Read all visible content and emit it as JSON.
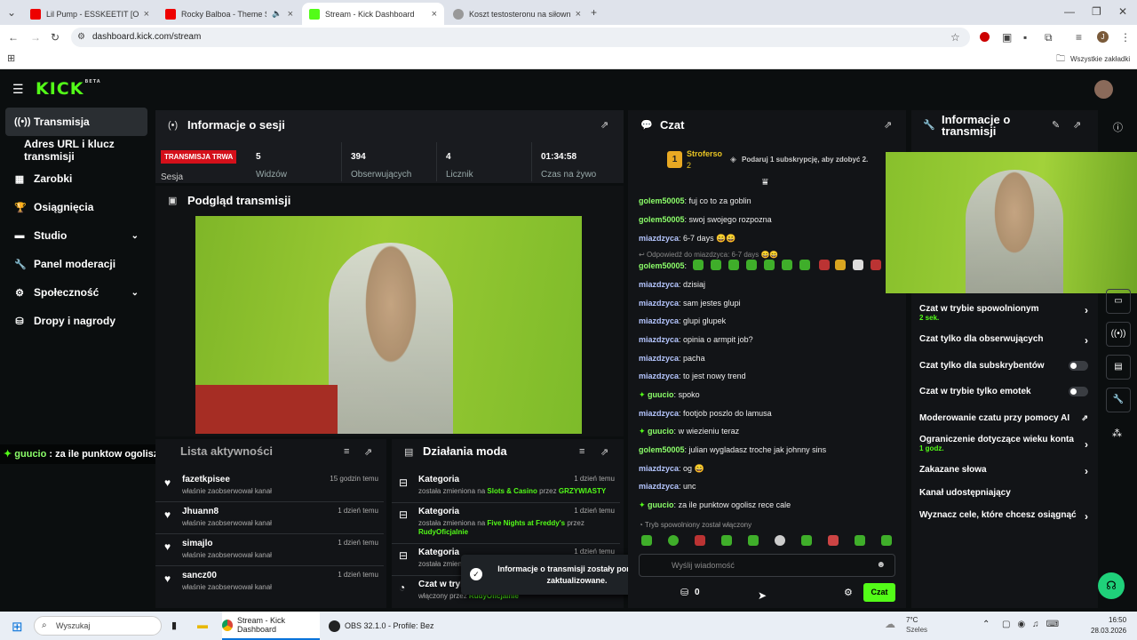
{
  "browser": {
    "tabs": [
      {
        "title": "Lil Pump - ESSKEETIT [Official M"
      },
      {
        "title": "Rocky Balboa - Theme Song"
      },
      {
        "title": "Stream - Kick Dashboard"
      },
      {
        "title": "Koszt testosteronu na siłownie"
      }
    ],
    "url": "dashboard.kick.com/stream",
    "bookmarks_label": "Wszystkie zakładki",
    "profile_initial": "J"
  },
  "kick": {
    "logo": "KICK",
    "logo_badge": "BETA"
  },
  "sidebar": {
    "items": [
      {
        "label": "Transmisja"
      },
      {
        "label": "Adres URL i klucz transmisji"
      },
      {
        "label": "Zarobki"
      },
      {
        "label": "Osiągnięcia"
      },
      {
        "label": "Studio"
      },
      {
        "label": "Panel moderacji"
      },
      {
        "label": "Społeczność"
      },
      {
        "label": "Dropy i nagrody"
      }
    ]
  },
  "session": {
    "title": "Informacje o sesji",
    "live_badge": "TRANSMISJA TRWA",
    "session_label": "Sesja",
    "stats": [
      {
        "value": "5",
        "label": "Widzów"
      },
      {
        "value": "394",
        "label": "Obserwujących"
      },
      {
        "value": "4",
        "label": "Licznik"
      },
      {
        "value": "01:34:58",
        "label": "Czas na żywo"
      }
    ]
  },
  "preview": {
    "title": "Podgląd transmisji"
  },
  "overlay_chat": {
    "user": "guucio",
    "text": " : za ile punktow ogolisz rece cale"
  },
  "activity": {
    "title": "Lista aktywności",
    "items": [
      {
        "name": "fazetkpisee",
        "sub": "właśnie zaobserwował kanał",
        "time": "15 godzin temu"
      },
      {
        "name": "Jhuann8",
        "sub": "właśnie zaobserwował kanał",
        "time": "1 dzień temu"
      },
      {
        "name": "simajlo",
        "sub": "właśnie zaobserwował kanał",
        "time": "1 dzień temu"
      },
      {
        "name": "sancz00",
        "sub": "właśnie zaobserwował kanał",
        "time": "1 dzień temu"
      }
    ]
  },
  "mod": {
    "title": "Działania moda",
    "items": [
      {
        "name": "Kategoria",
        "sub_pre": "została zmieniona na ",
        "cat": "Slots & Casino",
        "sub_mid": " przez ",
        "by": "GRZYWIASTY",
        "time": "1 dzień temu"
      },
      {
        "name": "Kategoria",
        "sub_pre": "została zmieniona na ",
        "cat": "Five Nights at Freddy's",
        "sub_mid": " przez ",
        "by": "RudyOficjalnie",
        "time": "1 dzień temu"
      },
      {
        "name": "Kategoria",
        "sub_pre": "została zmien",
        "time": "1 dzień temu"
      },
      {
        "name": "Czat w tryb",
        "sub_pre": "włączony przez ",
        "by": "RudyOficjalnie"
      }
    ]
  },
  "toast": {
    "text": "Informacje o transmisji zostały pomyślnie zaktualizowane."
  },
  "chat": {
    "title": "Czat",
    "pinned_user": "Stroferso",
    "pinned_rank": "1",
    "pinned_count": "2",
    "gift_text": "Podaruj 1 subskrypcję, aby zdobyć 2.",
    "messages": [
      {
        "user": "golem50005",
        "text": "fuj co to za goblin",
        "color": "g"
      },
      {
        "user": "golem50005",
        "text": "swoj swojego rozpozna",
        "color": "g"
      },
      {
        "user": "miazdzyca",
        "text": "6-7 days 😄😄",
        "color": "b"
      },
      {
        "user": "golem50005",
        "text": "",
        "color": "g"
      },
      {
        "user": "miazdzyca",
        "text": "dzisiaj",
        "color": "b"
      },
      {
        "user": "miazdzyca",
        "text": "sam jestes glupi",
        "color": "b"
      },
      {
        "user": "miazdzyca",
        "text": "glupi glupek",
        "color": "b"
      },
      {
        "user": "miazdzyca",
        "text": "opinia o armpit job?",
        "color": "b"
      },
      {
        "user": "miazdzyca",
        "text": "pacha",
        "color": "b"
      },
      {
        "user": "miazdzyca",
        "text": "to jest nowy trend",
        "color": "b"
      },
      {
        "user": "guucio",
        "text": "spoko",
        "color": "g"
      },
      {
        "user": "miazdzyca",
        "text": "footjob poszlo do lamusa",
        "color": "b"
      },
      {
        "user": "guucio",
        "text": "w wiezieniu teraz",
        "color": "g"
      },
      {
        "user": "golem50005",
        "text": "julian wygladasz troche jak johnny sins",
        "color": "g"
      },
      {
        "user": "miazdzyca",
        "text": "og 😄",
        "color": "b"
      },
      {
        "user": "miazdzyca",
        "text": "unc",
        "color": "b"
      },
      {
        "user": "guucio",
        "text": "za ile punktow ogolisz rece cale",
        "color": "g"
      }
    ],
    "reply_note": "Odpowiedź do miazdzyca: 6-7 days 😄😄",
    "slow_mode_note": "Tryb spowolniony został włączony",
    "input_placeholder": "Wyślij wiadomość",
    "points": "0",
    "send_label": "Czat"
  },
  "stream_info": {
    "title": "Informacje o transmisji",
    "settings": [
      {
        "label": "Czat w trybie spowolnionym",
        "sub": "2 sek.",
        "ctrl": "arrow"
      },
      {
        "label": "Czat tylko dla obserwujących",
        "ctrl": "arrow"
      },
      {
        "label": "Czat tylko dla subskrybentów",
        "ctrl": "toggle"
      },
      {
        "label": "Czat w trybie tylko emotek",
        "ctrl": "toggle"
      },
      {
        "label": "Moderowanie czatu przy pomocy AI",
        "ctrl": "ext"
      },
      {
        "label": "Ograniczenie dotyczące wieku konta",
        "sub": "1 godz.",
        "ctrl": "arrow"
      },
      {
        "label": "Zakazane słowa",
        "ctrl": "arrow"
      },
      {
        "label": "Kanał udostępniający",
        "ctrl": "none"
      },
      {
        "label": "Wyznacz cele, które chcesz osiągnąć",
        "ctrl": "arrow"
      }
    ]
  },
  "taskbar": {
    "search_placeholder": "Wyszukaj",
    "apps": [
      {
        "label": "Stream - Kick Dashboard"
      },
      {
        "label": "OBS 32.1.0 - Profile: Bez"
      }
    ],
    "weather_temp": "7°C",
    "weather_desc": "Szeles",
    "time": "16:50",
    "date": "28.03.2026"
  }
}
